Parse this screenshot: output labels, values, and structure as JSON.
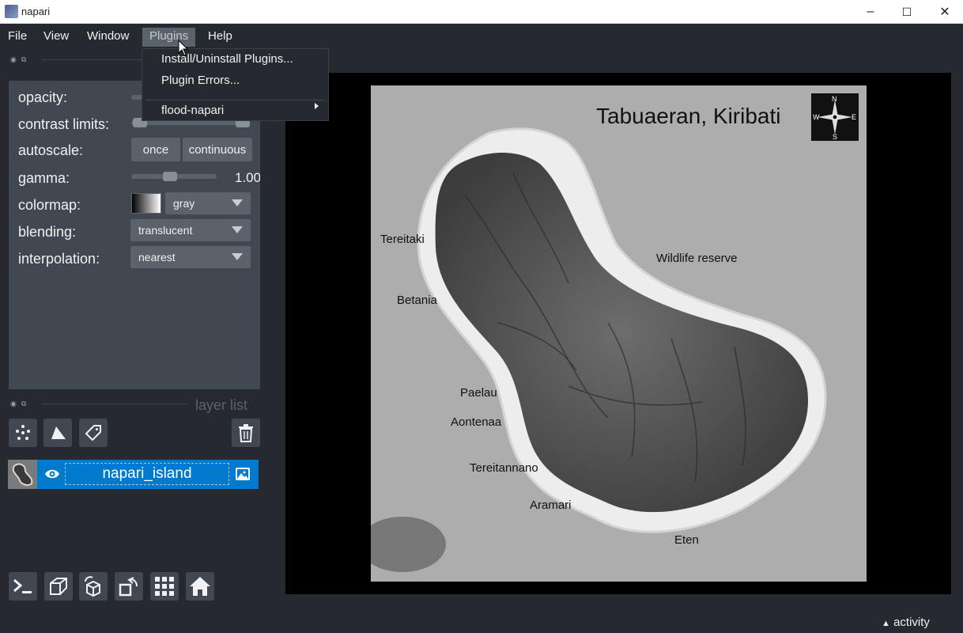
{
  "window": {
    "title": "napari",
    "minimize": "–",
    "maximize": "☐",
    "close": "✕"
  },
  "menubar": {
    "items": [
      "File",
      "View",
      "Window",
      "Plugins",
      "Help"
    ],
    "active": "Plugins"
  },
  "plugins_menu": {
    "items": [
      "Install/Uninstall Plugins...",
      "Plugin Errors...",
      "flood-napari"
    ],
    "submenu_item": "flood-napari"
  },
  "layer_controls": {
    "opacity_label": "opacity:",
    "contrast_label": "contrast limits:",
    "autoscale_label": "autoscale:",
    "autoscale_once": "once",
    "autoscale_continuous": "continuous",
    "gamma_label": "gamma:",
    "gamma_value": "1.00",
    "colormap_label": "colormap:",
    "colormap_value": "gray",
    "blending_label": "blending:",
    "blending_value": "translucent",
    "interpolation_label": "interpolation:",
    "interpolation_value": "nearest"
  },
  "layer_list": {
    "title": "layer list",
    "layers": [
      {
        "name": "napari_island",
        "visible": true,
        "type": "image"
      }
    ]
  },
  "tools": {
    "new_points": "points-icon",
    "new_shapes": "shapes-icon",
    "new_labels": "labels-icon",
    "delete": "trash-icon"
  },
  "bottom_buttons": [
    "console-icon",
    "ndisplay-icon",
    "roll-icon",
    "transpose-icon",
    "grid-icon",
    "home-icon"
  ],
  "map_image": {
    "title": "Tabuaeran, Kiribati",
    "compass": {
      "n": "N",
      "s": "S",
      "e": "E",
      "w": "W"
    },
    "places": [
      "Tereitaki",
      "Betania",
      "Wildlife reserve",
      "Paelau",
      "Aontenaa",
      "Tereitannano",
      "Aramari",
      "Eten"
    ]
  },
  "statusbar": {
    "activity": "activity"
  },
  "colors": {
    "background": "#262930",
    "panel": "#414851",
    "accent": "#007acc"
  }
}
